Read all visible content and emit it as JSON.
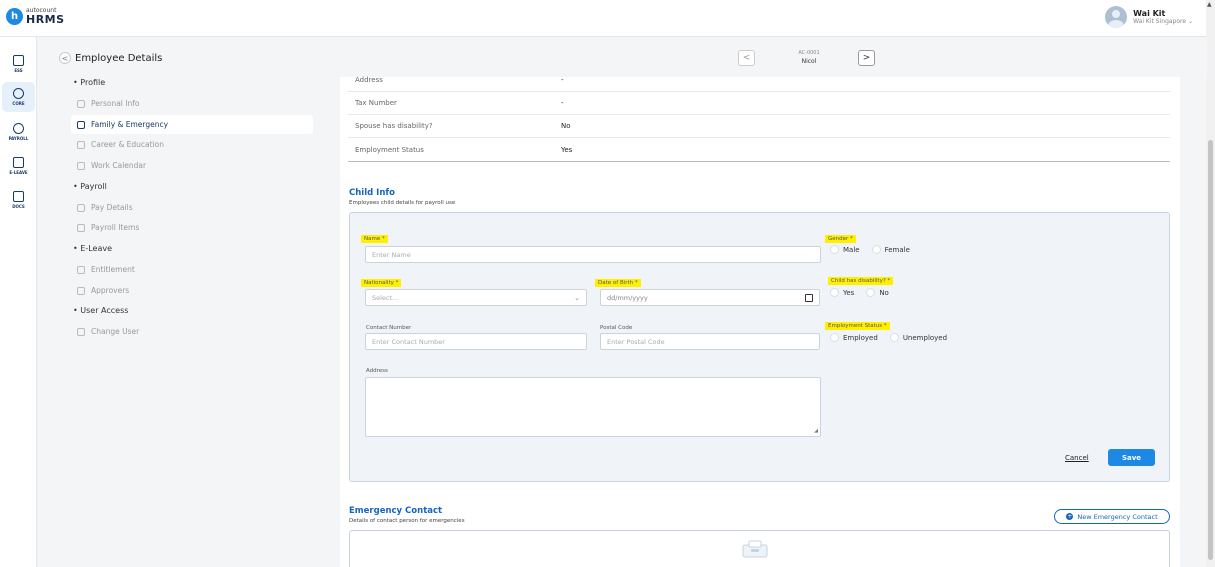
{
  "brand": {
    "small": "autocount",
    "big": "HRMS",
    "circle": "h"
  },
  "user": {
    "name": "Wai Kit",
    "company": "Wai Kit Singapore ⌄"
  },
  "rail": [
    {
      "label": "ESS",
      "icon": "ess-icon"
    },
    {
      "label": "CORE",
      "icon": "core-icon"
    },
    {
      "label": "PAYROLL",
      "icon": "payroll-icon"
    },
    {
      "label": "E-LEAVE",
      "icon": "eleave-icon"
    },
    {
      "label": "DOCS",
      "icon": "docs-icon"
    }
  ],
  "header": {
    "title": "Employee Details",
    "back": "<",
    "prev": "<",
    "next": ">",
    "emp_code": "AC-0001",
    "emp_name": "Nicol"
  },
  "menu": {
    "sections": [
      "Profile",
      "Payroll",
      "E-Leave",
      "User Access"
    ],
    "items": [
      "Personal Info",
      "Family & Emergency",
      "Career & Education",
      "Work Calendar",
      "Pay Details",
      "Payroll Items",
      "Entitlement",
      "Approvers",
      "Change User"
    ]
  },
  "spouse_rows": [
    {
      "label": "Address",
      "value": "-"
    },
    {
      "label": "Tax Number",
      "value": "-"
    },
    {
      "label": "Spouse has disability?",
      "value": "No"
    },
    {
      "label": "Employment Status",
      "value": "Yes"
    }
  ],
  "child": {
    "title": "Child Info",
    "subtitle": "Employees child details for payroll use",
    "name_label": "Name *",
    "name_placeholder": "Enter Name",
    "gender_label": "Gender *",
    "gender_options": [
      "Male",
      "Female"
    ],
    "nationality_label": "Nationality *",
    "nationality_placeholder": "Select...",
    "dob_label": "Date of Birth *",
    "dob_placeholder": "dd/mm/yyyy",
    "disability_label": "Child has disability? *",
    "disability_options": [
      "Yes",
      "No"
    ],
    "contact_label": "Contact Number",
    "contact_placeholder": "Enter Contact Number",
    "postal_label": "Postal Code",
    "postal_placeholder": "Enter Postal Code",
    "employment_label": "Employment Status *",
    "employment_options": [
      "Employed",
      "Unemployed"
    ],
    "address_label": "Address",
    "cancel": "Cancel",
    "save": "Save"
  },
  "emergency": {
    "title": "Emergency Contact",
    "subtitle": "Details of contact person for emergencies",
    "new_button": "New Emergency Contact"
  },
  "colors": {
    "accent": "#1e88e5",
    "highlight": "#fff000",
    "title_blue": "#1565c0"
  }
}
